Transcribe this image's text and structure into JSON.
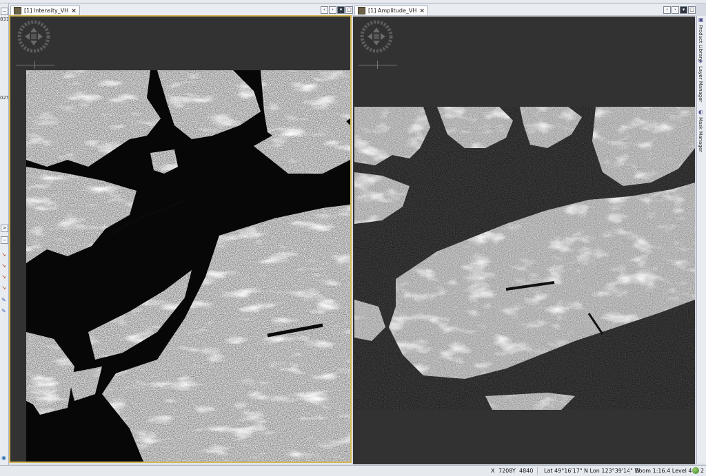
{
  "left_gutter": {
    "snippet_1": "831",
    "snippet_2": "02T",
    "expand_arrow": ">"
  },
  "views": [
    {
      "tab_label": "[1] Intensity_VH",
      "close_glyph": "×",
      "active": true
    },
    {
      "tab_label": "[1] Amplitude_VH",
      "close_glyph": "×",
      "active": false
    }
  ],
  "window_controls": {
    "prev": "‹",
    "next": "›",
    "menu": "▾",
    "maximize": "□"
  },
  "side_tools": [
    {
      "label": "Product Library",
      "icon": "library-icon"
    },
    {
      "label": "Layer Manager",
      "icon": "layers-icon"
    },
    {
      "label": "Mask Manager",
      "icon": "mask-icon"
    }
  ],
  "status": {
    "x_label": "X",
    "x_value": "7208",
    "y_label": "Y",
    "y_value": "4840",
    "latlon": "Lat 49°16'17\" N Lon 123°39'14\" W",
    "zoom": "Zoom 1:16.4 Level 4",
    "globe_count": "2"
  },
  "colors": {
    "active_border": "#d5b654",
    "canvas_bg": "#323232",
    "water": "#060606"
  }
}
